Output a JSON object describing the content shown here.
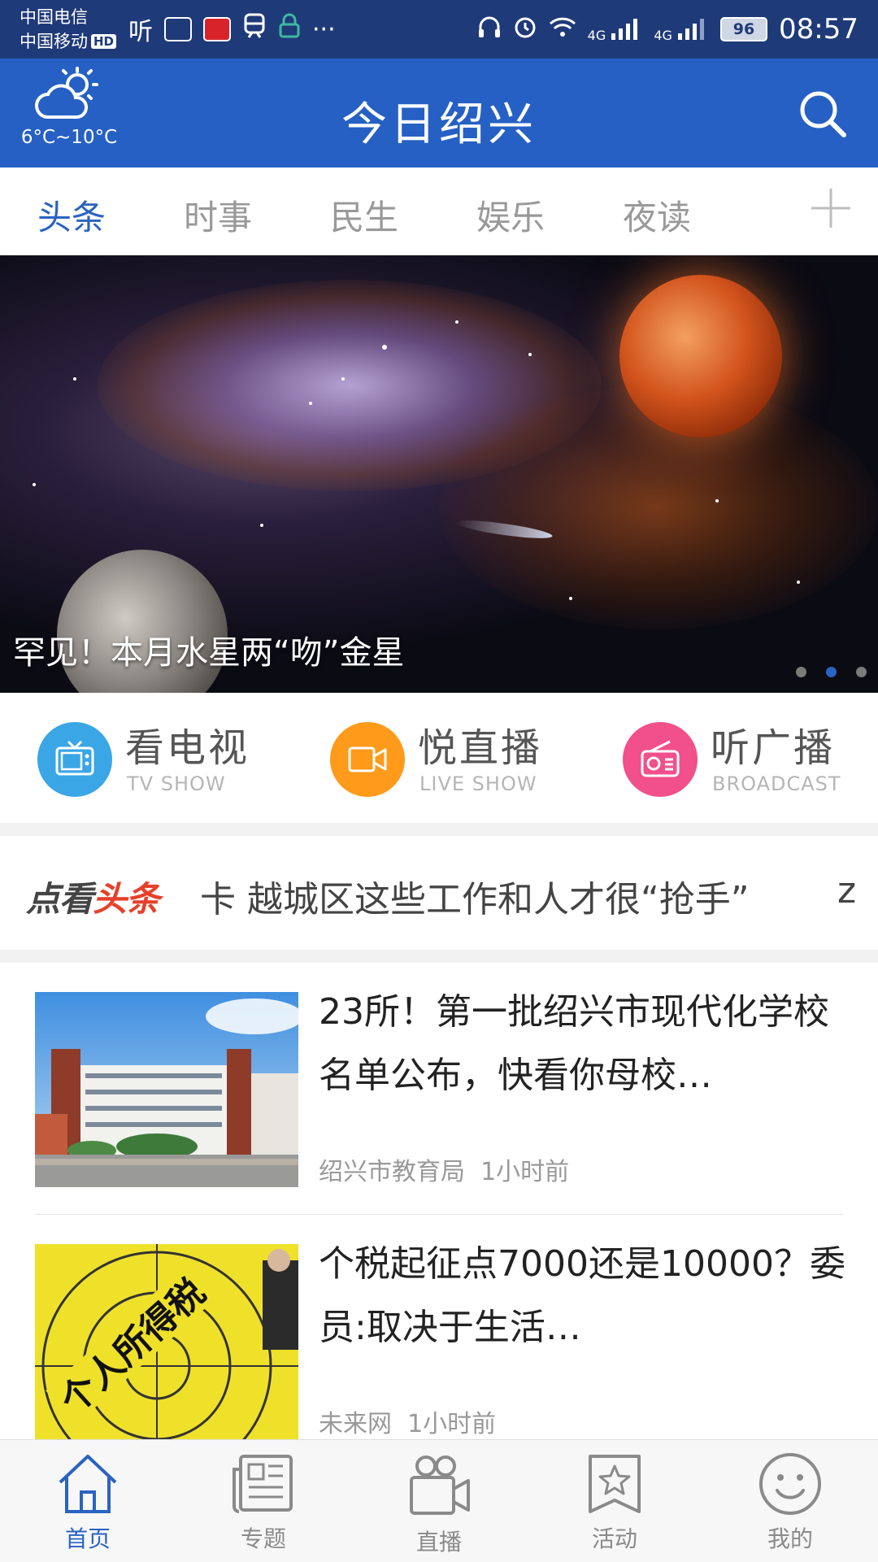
{
  "status_bar": {
    "carrier1": "中国电信",
    "carrier2": "中国移动",
    "hd": "HD",
    "listen_icon_text": "听",
    "battery": "96",
    "network1": "4G",
    "network2": "4G",
    "time": "08:57",
    "more": "···"
  },
  "header": {
    "weather_temp": "6°C~10°C",
    "title": "今日绍兴",
    "search_icon": "search-icon",
    "weather_icon": "partly-cloudy-icon"
  },
  "tabs": [
    {
      "label": "头条",
      "active": true
    },
    {
      "label": "时事"
    },
    {
      "label": "民生"
    },
    {
      "label": "娱乐"
    },
    {
      "label": "夜读"
    }
  ],
  "banner": {
    "caption": "罕见！本月水星两“吻”金星",
    "slide_count": 3,
    "active_slide": 2
  },
  "quick_entries": [
    {
      "label": "看电视",
      "sub": "TV SHOW",
      "color": "#3aa6e6",
      "icon": "tv-icon"
    },
    {
      "label": "悦直播",
      "sub": "LIVE SHOW",
      "color": "#ff9a1a",
      "icon": "video-camera-icon"
    },
    {
      "label": "听广播",
      "sub": "BROADCAST",
      "color": "#f2508a",
      "icon": "radio-icon"
    }
  ],
  "ticker": {
    "logo_part1": "点看",
    "logo_part2": "头条",
    "text": "卡 越城区这些工作和人才很“抢手”",
    "tail": "z"
  },
  "news": [
    {
      "title": "23所！第一批绍兴市现代化学校名单公布，快看你母校…",
      "source": "绍兴市教育局",
      "time": "1小时前"
    },
    {
      "title": "个税起征点7000还是10000？委员:取决于生活…",
      "source": "未来网",
      "time": "1小时前"
    }
  ],
  "bottom_nav": [
    {
      "label": "首页",
      "icon": "home-icon",
      "active": true
    },
    {
      "label": "专题",
      "icon": "newspaper-icon"
    },
    {
      "label": "直播",
      "icon": "video-camera-icon"
    },
    {
      "label": "活动",
      "icon": "star-bookmark-icon"
    },
    {
      "label": "我的",
      "icon": "smiley-icon"
    }
  ],
  "colors": {
    "status_bar": "#1f3a78",
    "header": "#2660c4",
    "accent": "#2a63c1"
  }
}
